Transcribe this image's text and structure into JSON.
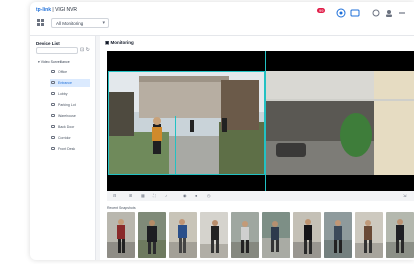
{
  "header": {
    "brand_logo": "tp-link",
    "brand_product": "VIGI NVR",
    "site_selector": "All Monitoring",
    "alert_count": "99",
    "icons": [
      "bell-icon",
      "message-icon",
      "settings-icon",
      "user-icon",
      "more-icon"
    ]
  },
  "sidebar": {
    "title": "Device List",
    "root_label": "Video Surveillance",
    "items": [
      {
        "label": "Office",
        "active": false
      },
      {
        "label": "Entrance",
        "active": true
      },
      {
        "label": "Lobby",
        "active": false
      },
      {
        "label": "Parking Lot",
        "active": false
      },
      {
        "label": "Warehouse",
        "active": false
      },
      {
        "label": "Back Door",
        "active": false
      },
      {
        "label": "Corridor",
        "active": false
      },
      {
        "label": "Front Desk",
        "active": false
      }
    ]
  },
  "main": {
    "title": "Monitoring",
    "recent_title": "Recent Snapshots",
    "thumbnail_count": 10
  },
  "colors": {
    "accent": "#1e6fd9",
    "selection_border": "#22c1c3",
    "active_bg": "#dbeafe"
  }
}
